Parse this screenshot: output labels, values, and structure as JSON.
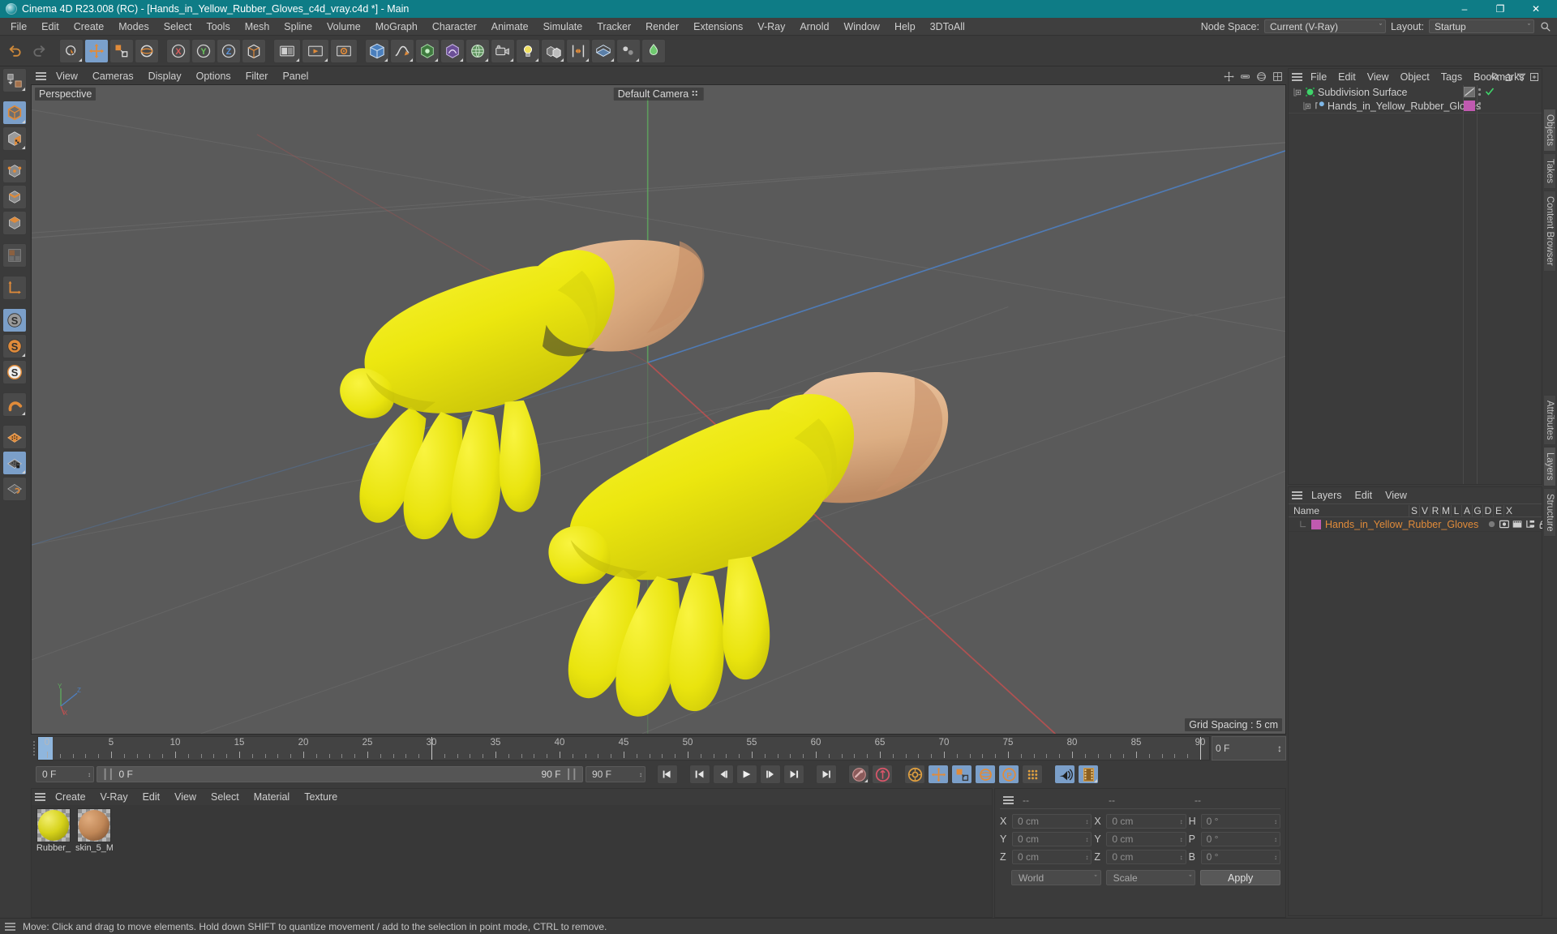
{
  "window": {
    "title": "Cinema 4D R23.008 (RC) - [Hands_in_Yellow_Rubber_Gloves_c4d_vray.c4d *] - Main",
    "minimize": "–",
    "maximize": "❐",
    "close": "✕",
    "accent": "#0e7c86"
  },
  "menubar": {
    "items": [
      {
        "label": "File"
      },
      {
        "label": "Edit"
      },
      {
        "label": "Create"
      },
      {
        "label": "Modes"
      },
      {
        "label": "Select"
      },
      {
        "label": "Tools"
      },
      {
        "label": "Mesh"
      },
      {
        "label": "Spline"
      },
      {
        "label": "Volume"
      },
      {
        "label": "MoGraph"
      },
      {
        "label": "Character"
      },
      {
        "label": "Animate"
      },
      {
        "label": "Simulate"
      },
      {
        "label": "Tracker"
      },
      {
        "label": "Render"
      },
      {
        "label": "Extensions"
      },
      {
        "label": "V-Ray"
      },
      {
        "label": "Arnold"
      },
      {
        "label": "Window"
      },
      {
        "label": "Help"
      },
      {
        "label": "3DToAll"
      }
    ],
    "node_space_label": "Node Space:",
    "node_space_value": "Current (V-Ray)",
    "layout_label": "Layout:",
    "layout_value": "Startup",
    "search_icon": "search-icon",
    "chevron": "ˇ"
  },
  "toolbar": {
    "buttons": [
      {
        "name": "undo-button",
        "icon": "undo-icon"
      },
      {
        "name": "redo-button",
        "icon": "redo-icon"
      },
      {
        "name": "select-live-button",
        "icon": "cursor-select-icon"
      },
      {
        "name": "move-button",
        "icon": "move-axis-icon"
      },
      {
        "name": "scale-button",
        "icon": "scale-icon"
      },
      {
        "name": "rotate-button",
        "icon": "rotate-icon"
      },
      {
        "name": "axis-lock-x-button",
        "icon": "axis-x-icon"
      },
      {
        "name": "axis-lock-y-button",
        "icon": "axis-y-icon"
      },
      {
        "name": "axis-lock-z-button",
        "icon": "axis-z-icon"
      },
      {
        "name": "world-coord-button",
        "icon": "world-axis-icon"
      },
      {
        "name": "render-view-button",
        "icon": "render-view-icon"
      },
      {
        "name": "render-queue-button",
        "icon": "render-queue-icon"
      },
      {
        "name": "render-settings-button",
        "icon": "render-settings-icon"
      },
      {
        "name": "add-cube-button",
        "icon": "cube-icon"
      },
      {
        "name": "add-spline-button",
        "icon": "spline-pen-icon"
      },
      {
        "name": "add-generator-button",
        "icon": "generator-icon"
      },
      {
        "name": "add-deformer-button",
        "icon": "deformer-icon"
      },
      {
        "name": "add-environment-button",
        "icon": "environment-icon"
      },
      {
        "name": "add-camera-button",
        "icon": "camera-icon"
      },
      {
        "name": "add-light-button",
        "icon": "light-bulb-icon"
      },
      {
        "name": "mograph-button",
        "icon": "mograph-icon"
      },
      {
        "name": "deformer-bend-button",
        "icon": "bend-icon"
      },
      {
        "name": "field-button",
        "icon": "field-icon"
      }
    ]
  },
  "left_toolbar": {
    "buttons": [
      {
        "name": "make-editable-button",
        "icon": "make-editable-icon",
        "active": false
      },
      {
        "name": "model-mode-button",
        "icon": "model-cube-icon",
        "active": true
      },
      {
        "name": "texture-mode-button",
        "icon": "texture-checker-icon",
        "active": false
      },
      {
        "name": "points-mode-button",
        "icon": "points-icon",
        "active": false
      },
      {
        "name": "edges-mode-button",
        "icon": "edges-icon",
        "active": false
      },
      {
        "name": "polygons-mode-button",
        "icon": "polygons-icon",
        "active": false
      },
      {
        "name": "uv-mode-button",
        "icon": "uv-icon",
        "active": false
      },
      {
        "name": "axis-mode-button",
        "icon": "axis-l-icon",
        "active": false
      },
      {
        "name": "enable-axis-button",
        "icon": "s-grey-icon",
        "active": true
      },
      {
        "name": "object-axis-button",
        "icon": "s-orange-icon",
        "active": false
      },
      {
        "name": "world-axis-button",
        "icon": "s-white-icon",
        "active": false
      },
      {
        "name": "snap-button",
        "icon": "magnet-icon",
        "active": false
      },
      {
        "name": "workplane-button",
        "icon": "workplane-icon",
        "active": false
      },
      {
        "name": "lock-workplane-button",
        "icon": "workplane-lock-icon",
        "active": true
      },
      {
        "name": "align-workplane-button",
        "icon": "workplane-rotate-icon",
        "active": false
      }
    ]
  },
  "viewport": {
    "menu": [
      "View",
      "Cameras",
      "Display",
      "Options",
      "Filter",
      "Panel"
    ],
    "perspective_label": "Perspective",
    "camera_label": "Default Camera",
    "grid_spacing_label": "Grid Spacing : 5 cm",
    "axis_labels": {
      "x": "X",
      "y": "Y",
      "z": "Z"
    },
    "background_color": "#5a5a5a",
    "glove_color": "#ece70f",
    "skin_color": "#d9a97e",
    "icons": {
      "move_cam": "pan-camera-icon",
      "zoom_cam": "zoom-camera-icon",
      "rotate_cam": "orbit-camera-icon",
      "maximize_view": "maximize-viewport-icon"
    }
  },
  "timeline": {
    "ticks": [
      0,
      5,
      10,
      15,
      20,
      25,
      30,
      35,
      40,
      45,
      50,
      55,
      60,
      65,
      70,
      75,
      80,
      85,
      90
    ],
    "start": 0,
    "end": 90,
    "current_frame_label": "0 F",
    "end_field_label": "0 F"
  },
  "animbar": {
    "current_frame": "0 F",
    "preview_range": "0 F",
    "preview_end": "90 F",
    "end_frame": "90 F",
    "buttons": [
      {
        "name": "go-to-start-button",
        "icon": "skip-start-icon"
      },
      {
        "name": "go-to-previous-key-button",
        "icon": "prev-key-icon"
      },
      {
        "name": "go-to-previous-frame-button",
        "icon": "step-back-icon"
      },
      {
        "name": "play-button",
        "icon": "play-icon"
      },
      {
        "name": "go-to-next-frame-button",
        "icon": "step-forward-icon"
      },
      {
        "name": "go-to-next-key-button",
        "icon": "next-key-icon"
      },
      {
        "name": "go-to-end-button",
        "icon": "skip-end-icon"
      },
      {
        "name": "record-active-objects-button",
        "icon": "record-key-icon"
      },
      {
        "name": "autokeying-button",
        "icon": "autokey-icon"
      },
      {
        "name": "keyframe-selection-button",
        "icon": "keyframe-gear-icon"
      },
      {
        "name": "position-key-button",
        "icon": "position-key-icon"
      },
      {
        "name": "scale-key-button",
        "icon": "scale-key-icon"
      },
      {
        "name": "rotation-key-button",
        "icon": "rotation-key-icon"
      },
      {
        "name": "parameter-key-button",
        "icon": "parameter-key-icon"
      },
      {
        "name": "point-level-animation-button",
        "icon": "pla-dots-icon"
      },
      {
        "name": "sound-button",
        "icon": "sound-icon"
      },
      {
        "name": "preview-range-button",
        "icon": "film-strip-icon"
      }
    ]
  },
  "material_manager": {
    "menu": [
      "Create",
      "V-Ray",
      "Edit",
      "View",
      "Select",
      "Material",
      "Texture"
    ],
    "materials": [
      {
        "name": "Rubber_",
        "color": "#d6d21a",
        "label": "Rubber_"
      },
      {
        "name": "skin_5_M",
        "color": "#c08757",
        "label": "skin_5_M"
      }
    ]
  },
  "coordinates": {
    "header": [
      "--",
      "--",
      "--"
    ],
    "rows": [
      {
        "pos_label": "X",
        "pos_value": "0 cm",
        "size_label": "X",
        "size_value": "0 cm",
        "rot_label": "H",
        "rot_value": "0 °"
      },
      {
        "pos_label": "Y",
        "pos_value": "0 cm",
        "size_label": "Y",
        "size_value": "0 cm",
        "rot_label": "P",
        "rot_value": "0 °"
      },
      {
        "pos_label": "Z",
        "pos_value": "0 cm",
        "size_label": "Z",
        "size_value": "0 cm",
        "rot_label": "B",
        "rot_value": "0 °"
      }
    ],
    "coord_system": "World",
    "transform_mode": "Scale",
    "apply_label": "Apply"
  },
  "object_manager": {
    "menu": [
      "File",
      "Edit",
      "View",
      "Object",
      "Tags",
      "Bookmarks"
    ],
    "icons": [
      "search-icon",
      "home-icon",
      "filter-icon",
      "add-layer-icon"
    ],
    "items": [
      {
        "label": "Subdivision Surface",
        "icon": "subdivision-surface-icon",
        "tag_color": "#6f6f6f",
        "has_check": true,
        "indent": 0
      },
      {
        "label": "Hands_in_Yellow_Rubber_Gloves",
        "icon": "polygon-object-icon",
        "tag_color": "#c05ab0",
        "has_check": false,
        "indent": 1
      }
    ]
  },
  "layers_manager": {
    "menu": [
      "Layers",
      "Edit",
      "View"
    ],
    "columns": [
      "Name",
      "S",
      "V",
      "R",
      "M",
      "L",
      "A",
      "G",
      "D",
      "E",
      "X"
    ],
    "rows": [
      {
        "label": "Hands_in_Yellow_Rubber_Gloves",
        "color": "#c05ab0"
      }
    ]
  },
  "vertical_tabs": {
    "right": [
      "Objects",
      "Takes",
      "Content Browser",
      "Attributes",
      "Layers",
      "Structure"
    ]
  },
  "statusbar": {
    "message": "Move: Click and drag to move elements. Hold down SHIFT to quantize movement / add to the selection in point mode, CTRL to remove."
  }
}
